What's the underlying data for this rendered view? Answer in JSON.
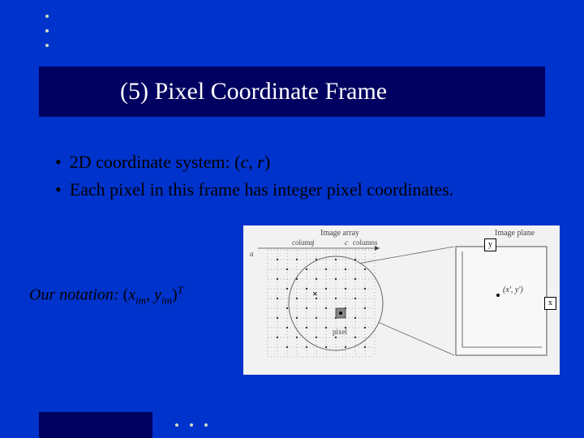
{
  "title": "(5) Pixel Coordinate Frame",
  "bullets": [
    {
      "pre": "2D coordinate system: (",
      "var1": "c",
      "mid": ", ",
      "var2": "r",
      "post": ")"
    },
    {
      "text": "Each pixel in this frame has integer pixel coordinates."
    }
  ],
  "notation": {
    "prefix_italic": "Our notation:",
    "open": " (",
    "x": "x",
    "sub1": "im",
    "comma": ", ",
    "y": "y",
    "sub2": "im",
    "close": ")",
    "T": "T"
  },
  "figure": {
    "left_label": "Image array",
    "right_label": "Image plane",
    "column_label": "column",
    "columns_label": "columns",
    "j": "j",
    "c": "c",
    "a_label": "a",
    "pixel_label": "pixel",
    "point_xy": "(x', y')",
    "y": "y",
    "x": "x",
    "grid_size": 11
  }
}
